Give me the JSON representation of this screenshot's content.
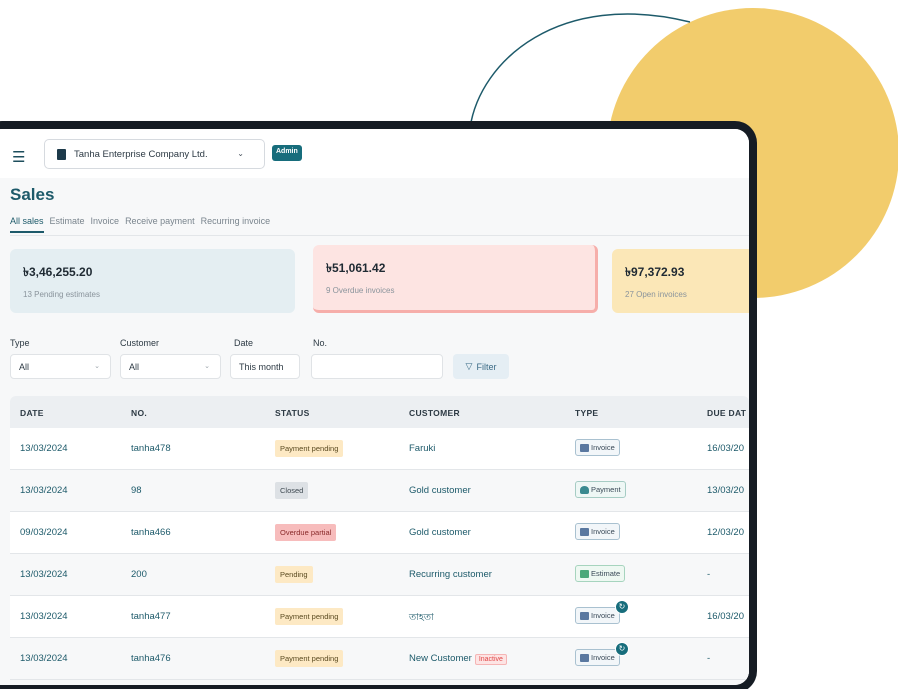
{
  "app": {
    "company_name": "Tanha Enterprise Company Ltd.",
    "role_badge": "Admin",
    "page_title": "Sales"
  },
  "tabs": [
    {
      "label": "All sales",
      "active": true
    },
    {
      "label": "Estimate",
      "active": false
    },
    {
      "label": "Invoice",
      "active": false
    },
    {
      "label": "Receive payment",
      "active": false
    },
    {
      "label": "Recurring invoice",
      "active": false
    }
  ],
  "summary": [
    {
      "amount": "৳3,46,255.20",
      "label": "13 Pending estimates"
    },
    {
      "amount": "৳51,061.42",
      "label": "9 Overdue invoices"
    },
    {
      "amount": "৳97,372.93",
      "label": "27 Open invoices"
    }
  ],
  "filters": {
    "type_label": "Type",
    "type_value": "All",
    "customer_label": "Customer",
    "customer_value": "All",
    "date_label": "Date",
    "date_value": "This month",
    "no_label": "No.",
    "no_value": "",
    "filter_button": "Filter"
  },
  "table": {
    "headers": [
      "DATE",
      "NO.",
      "STATUS",
      "CUSTOMER",
      "TYPE",
      "DUE DAT"
    ],
    "rows": [
      {
        "date": "13/03/2024",
        "no": "tanha478",
        "status": "Payment pending",
        "customer": "Faruki",
        "type": "Invoice",
        "due": "16/03/20"
      },
      {
        "date": "13/03/2024",
        "no": "98",
        "status": "Closed",
        "customer": "Gold customer",
        "type": "Payment",
        "due": "13/03/20"
      },
      {
        "date": "09/03/2024",
        "no": "tanha466",
        "status": "Overdue partial",
        "customer": "Gold customer",
        "type": "Invoice",
        "due": "12/03/20"
      },
      {
        "date": "13/03/2024",
        "no": "200",
        "status": "Pending",
        "customer": "Recurring customer",
        "type": "Estimate",
        "due": "-"
      },
      {
        "date": "13/03/2024",
        "no": "tanha477",
        "status": "Payment pending",
        "customer": "তাহতা",
        "type": "Invoice",
        "due": "16/03/20"
      },
      {
        "date": "13/03/2024",
        "no": "tanha476",
        "status": "Payment pending",
        "customer": "New Customer",
        "customer_tag": "Inactive",
        "type": "Invoice",
        "due": "-"
      }
    ]
  },
  "icons": {
    "menu": "menu-collapse-icon",
    "company": "building-icon",
    "filter": "funnel-icon",
    "recurring": "recurring-icon"
  },
  "colors": {
    "accent": "#1d5a6a",
    "deco_circle": "#f2cc6c",
    "overdue_card": "#fde4e2",
    "estimates_card": "#e4eef2",
    "open_card": "#fbe7b7"
  }
}
